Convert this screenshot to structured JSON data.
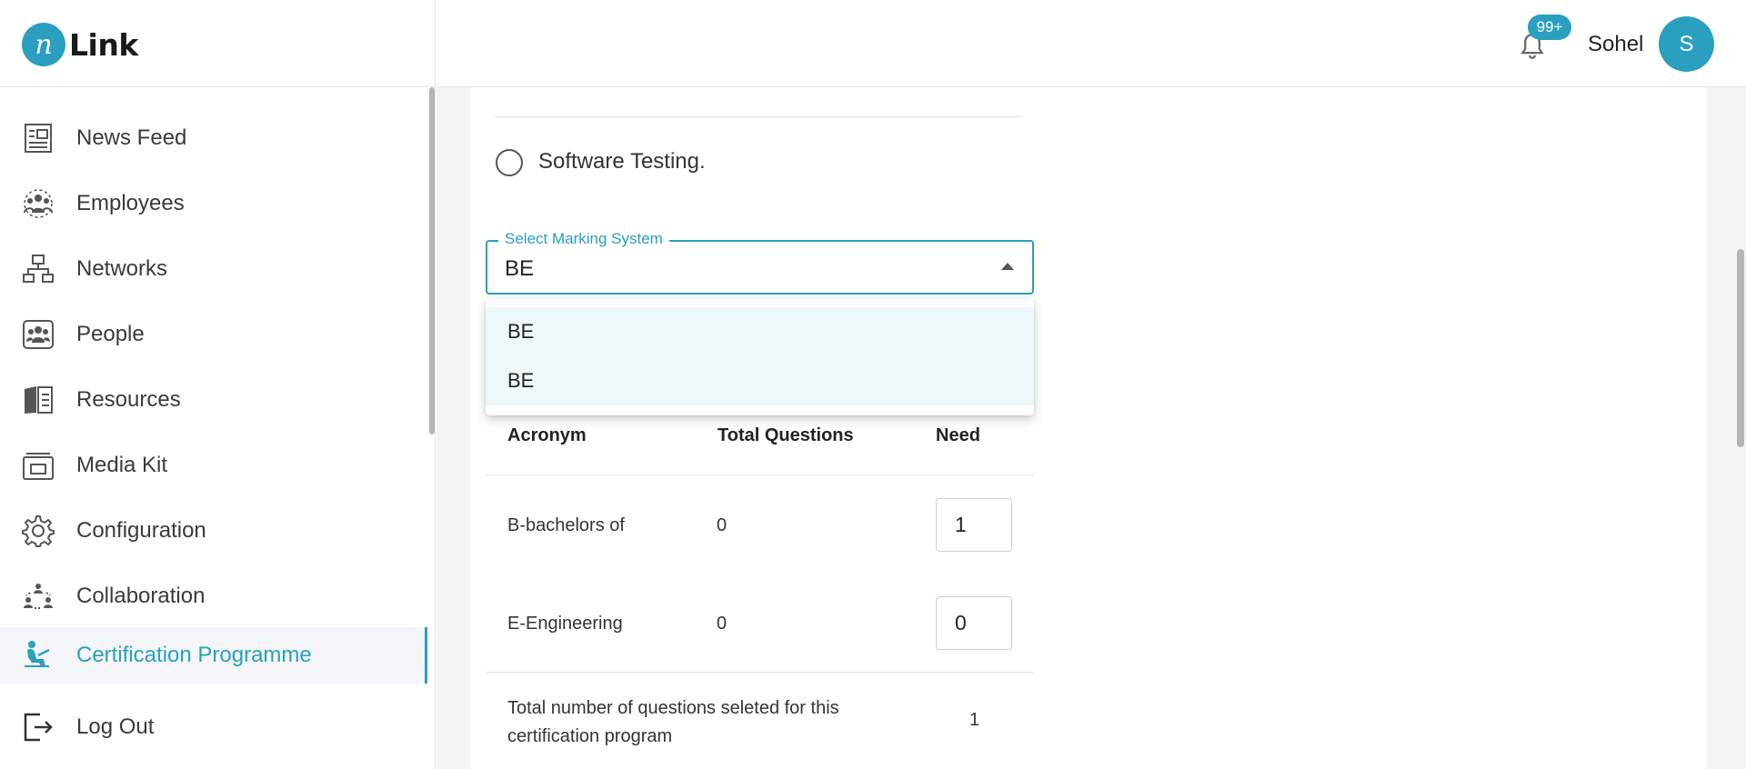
{
  "header": {
    "logo_mark": "n",
    "logo_text": "Link",
    "notification_count": "99+",
    "user_name": "Sohel",
    "avatar_initial": "S",
    "accent_color": "#2a9fc0"
  },
  "sidebar": {
    "items": [
      {
        "label": "News Feed",
        "icon": "newspaper-icon"
      },
      {
        "label": "Employees",
        "icon": "employees-icon"
      },
      {
        "label": "Networks",
        "icon": "network-icon"
      },
      {
        "label": "People",
        "icon": "people-icon"
      },
      {
        "label": "Resources",
        "icon": "book-icon"
      },
      {
        "label": "Media Kit",
        "icon": "media-kit-icon"
      },
      {
        "label": "Configuration",
        "icon": "gear-icon"
      },
      {
        "label": "Collaboration",
        "icon": "collaboration-icon"
      },
      {
        "label": "Certification Programme",
        "icon": "certification-icon",
        "active": true
      },
      {
        "label": "Log Out",
        "icon": "logout-icon"
      }
    ]
  },
  "form": {
    "radio_option_label": "Software Testing.",
    "marking_system": {
      "label": "Select Marking System",
      "value": "BE",
      "options": [
        "BE",
        "BE"
      ]
    },
    "table": {
      "headers": [
        "Acronym",
        "Total Questions",
        "Need"
      ],
      "rows": [
        {
          "acronym": "B-bachelors of",
          "total": "0",
          "need": "1"
        },
        {
          "acronym": "E-Engineering",
          "total": "0",
          "need": "0"
        }
      ]
    },
    "summary": {
      "label": "Total number of questions seleted for this certification program",
      "value": "1"
    }
  }
}
